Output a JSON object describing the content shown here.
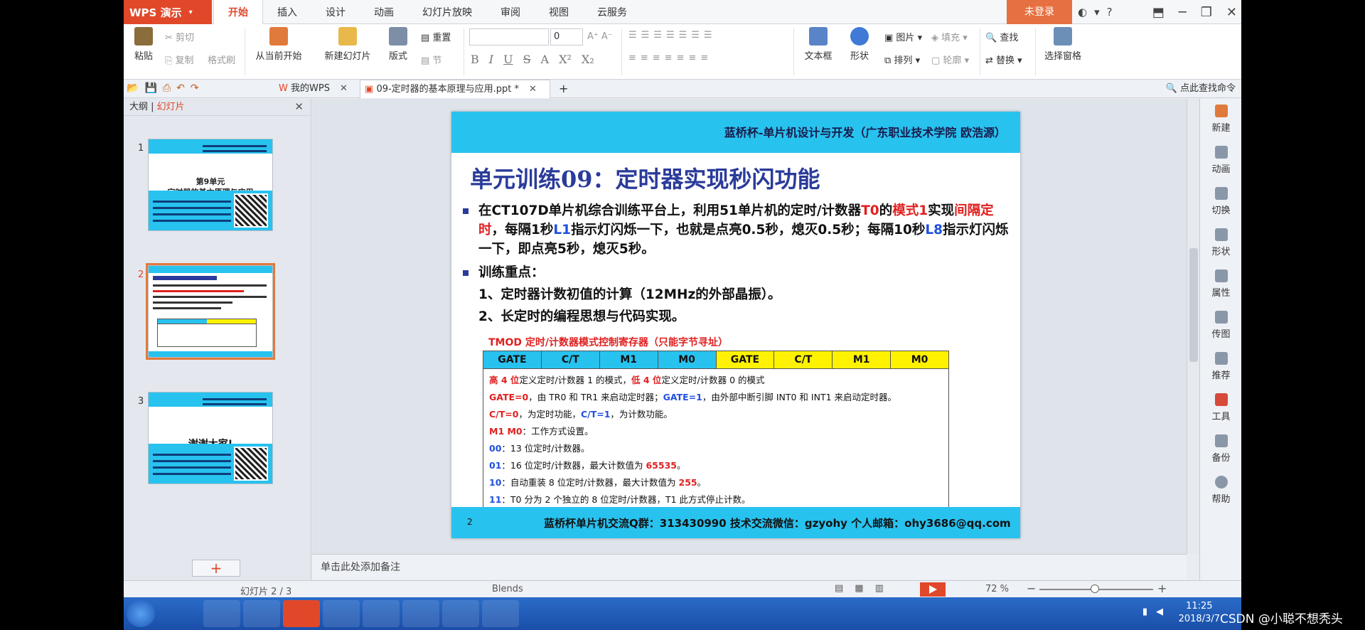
{
  "app": {
    "name": "WPS 演示",
    "login": "未登录"
  },
  "tabs": [
    "开始",
    "插入",
    "设计",
    "动画",
    "幻灯片放映",
    "审阅",
    "视图",
    "云服务"
  ],
  "ribbon": {
    "paste": "粘贴",
    "cut": "剪切",
    "copy": "复制",
    "format_painter": "格式刷",
    "from_current": "从当前开始",
    "new_slide": "新建幻灯片",
    "layout": "版式",
    "reset": "重置",
    "section": "节",
    "font_size": "0",
    "textbox": "文本框",
    "shape": "形状",
    "picture": "图片",
    "fill": "填充",
    "arrange": "排列",
    "outline": "轮廓",
    "find": "查找",
    "replace": "替换",
    "select_pane": "选择窗格"
  },
  "qa": {
    "my_wps": "我的WPS",
    "doc_tab": "09-定时器的基本原理与应用.ppt *",
    "search_cmd": "点此查找命令"
  },
  "left_panel": {
    "tab_outline": "大纲",
    "tab_slides": "幻灯片"
  },
  "thumbs": [
    {
      "num": "1",
      "title1": "第9单元",
      "title2": "定时器的基本原理与应用"
    },
    {
      "num": "2"
    },
    {
      "num": "3",
      "thanks": "谢谢大家!"
    }
  ],
  "slide": {
    "header": "蓝桥杯-单片机设计与开发（广东职业技术学院 欧浩源）",
    "title": "单元训练09：定时器实现秒闪功能",
    "p1_a": "在CT107D单片机综合训练平台上，利用51单片机的定时/计数器",
    "p1_t0": "T0",
    "p1_b": "的",
    "p1_mode": "模式1",
    "p1_c": "实现",
    "p1_interval": "间隔定时",
    "p1_d": "，每隔1秒",
    "p1_l1": "L1",
    "p1_e": "指示灯闪烁一下，也就是点亮0.5秒，熄灭0.5秒；每隔10秒",
    "p1_l8": "L8",
    "p1_f": "指示灯闪烁一下，即点亮5秒，熄灭5秒。",
    "focus_title": "训练重点：",
    "focus1": "1、定时器计数初值的计算（12MHz的外部晶振）。",
    "focus2": "2、长定时的编程思想与代码实现。",
    "tmod_label": "TMOD 定时/计数器模式控制寄存器（只能字节寻址）",
    "tmod_bits": [
      "GATE",
      "C/T",
      "M1",
      "M0",
      "GATE",
      "C/T",
      "M1",
      "M0"
    ],
    "desc": {
      "l1_a": "高 4 位",
      "l1_b": "定义定时/计数器 1 的模式，",
      "l1_c": "低 4 位",
      "l1_d": "定义定时/计数器 0 的模式",
      "l2_a": "GATE=0",
      "l2_b": "，由 TR0 和 TR1 来启动定时器；",
      "l2_c": "GATE=1",
      "l2_d": "，由外部中断引脚 INT0 和 INT1 来启动定时器。",
      "l3_a": "C/T=0",
      "l3_b": "，为定时功能，",
      "l3_c": "C/T=1",
      "l3_d": "，为计数功能。",
      "l4_a": "M1  M0",
      "l4_b": "：工作方式设置。",
      "l5_a": "00",
      "l5_b": "：13 位定时/计数器。",
      "l6_a": "01",
      "l6_b": "：16 位定时/计数器，最大计数值为 ",
      "l6_c": "65535",
      "l6_d": "。",
      "l7_a": "10",
      "l7_b": "：自动重装 8 位定时/计数器，最大计数值为 ",
      "l7_c": "255",
      "l7_d": "。",
      "l8_a": "11",
      "l8_b": "：T0 分为 2 个独立的 8 位定时/计数器，T1 此方式停止计数。"
    },
    "page_num": "2",
    "footer": "蓝桥杯单片机交流Q群：313430990    技术交流微信：gzyohy    个人邮箱：ohy3686@qq.com"
  },
  "right_sidebar": [
    "新建",
    "动画",
    "切换",
    "形状",
    "属性",
    "传图",
    "推荐",
    "工具",
    "备份",
    "帮助"
  ],
  "notes_placeholder": "单击此处添加备注",
  "status": {
    "slide": "幻灯片 2 / 3",
    "theme": "Blends",
    "zoom": "72 %"
  },
  "taskbar": {
    "time": "11:25",
    "date": "2018/3/7"
  },
  "watermark": "CSDN @小聪不想秃头"
}
